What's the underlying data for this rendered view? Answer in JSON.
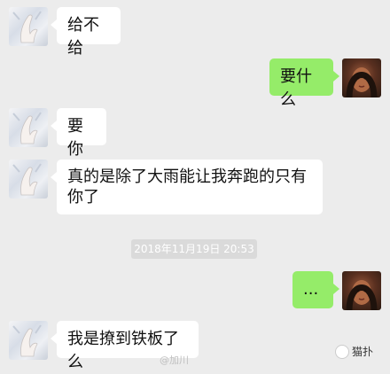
{
  "messages": [
    {
      "side": "left",
      "text": "给不给"
    },
    {
      "side": "right",
      "text": "要什么"
    },
    {
      "side": "left",
      "text": "要你"
    },
    {
      "side": "left",
      "text": "真的是除了大雨能让我奔跑的只有你了"
    },
    {
      "side": "right",
      "text": "..."
    },
    {
      "side": "left",
      "text": "我是撩到铁板了么"
    }
  ],
  "timestamp": "2018年11月19日 20:53",
  "watermark": {
    "weibo": "@加川",
    "brand": "猫扑"
  },
  "colors": {
    "background": "#ececec",
    "left_bubble": "#ffffff",
    "right_bubble": "#95ec69"
  }
}
